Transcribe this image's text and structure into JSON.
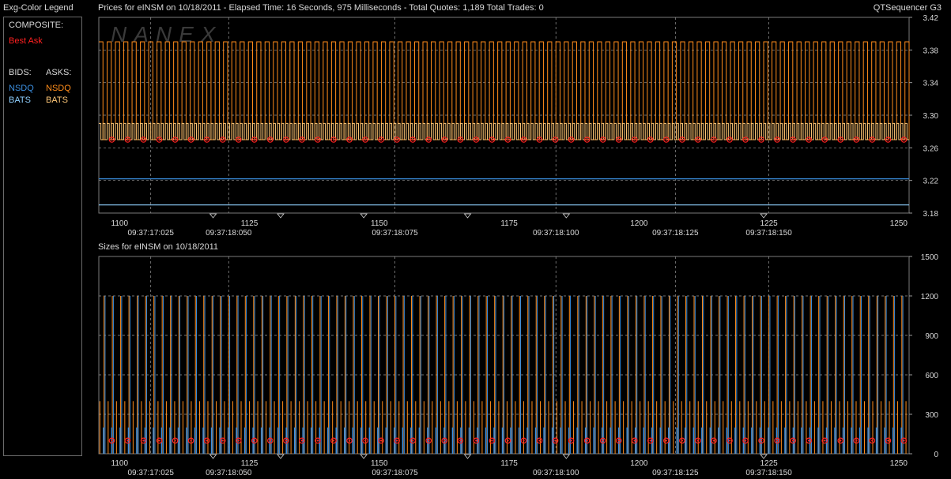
{
  "header": {
    "legend_title": "Exg-Color Legend",
    "title": "Prices for  eINSM  on  10/18/2011  -  Elapsed Time: 16 Seconds, 975 Milliseconds  -  Total Quotes: 1,189  Total Trades: 0",
    "app_name": "QTSequencer G3"
  },
  "legend": {
    "composite_label": "COMPOSITE:",
    "best_ask": "Best Ask",
    "bids_label": "BIDS:",
    "asks_label": "ASKS:",
    "bids": [
      "NSDQ",
      "BATS"
    ],
    "asks": [
      "NSDQ",
      "BATS"
    ]
  },
  "watermark": "NANEX",
  "colors": {
    "best_ask": "#ff2020",
    "nsdq_bid": "#3b8fe0",
    "bats_bid": "#8fd0ff",
    "nsdq_ask": "#ff8c1a",
    "bats_ask": "#ffc878",
    "grid": "#9a9a9a",
    "axis_text": "#d9d9d9"
  },
  "chart_data": [
    {
      "type": "line",
      "title": "Prices for  eINSM  on  10/18/2011  -  Elapsed Time: 16 Seconds, 975 Milliseconds  -  Total Quotes: 1,189  Total Trades: 0",
      "x_range": [
        1096,
        1252
      ],
      "y_range": [
        3.18,
        3.42
      ],
      "ytick_labels": [
        "3.42",
        "3.38",
        "3.34",
        "3.30",
        "3.26",
        "3.22",
        "3.18"
      ],
      "xtick_labels": [
        "1100",
        "1125",
        "1150",
        "1175",
        "1200",
        "1225",
        "1250"
      ],
      "time_labels": [
        "09:37:17:025",
        "09:37:18:050",
        "09:37:18:075",
        "09:37:18:100",
        "09:37:18:125",
        "09:37:18:150"
      ],
      "series": [
        {
          "name": "NSDQ",
          "side": "bid",
          "constant": 3.222
        },
        {
          "name": "BATS",
          "side": "bid",
          "constant": 3.19
        },
        {
          "name": "NSDQ",
          "side": "ask",
          "levels": [
            3.39,
            3.27
          ]
        },
        {
          "name": "BATS",
          "side": "ask",
          "levels": [
            3.29,
            3.27
          ]
        },
        {
          "name": "Best Ask",
          "value": 3.27
        }
      ],
      "grid": true
    },
    {
      "type": "bar",
      "title": "Sizes for  eINSM  on  10/18/2011",
      "x_range": [
        1096,
        1252
      ],
      "y_range": [
        0,
        1500
      ],
      "ytick_labels": [
        "1500",
        "1200",
        "900",
        "600",
        "300",
        "0"
      ],
      "xtick_labels": [
        "1100",
        "1125",
        "1150",
        "1175",
        "1200",
        "1225",
        "1250"
      ],
      "time_labels": [
        "09:37:17:025",
        "09:37:18:050",
        "09:37:18:075",
        "09:37:18:100",
        "09:37:18:125",
        "09:37:18:150"
      ],
      "series": [
        {
          "name": "NSDQ",
          "side": "bid",
          "size": 1200
        },
        {
          "name": "BATS",
          "side": "bid",
          "size": 200
        },
        {
          "name": "NSDQ",
          "side": "ask",
          "size": 1200
        },
        {
          "name": "BATS",
          "side": "ask",
          "size": 400
        },
        {
          "name": "Best Ask",
          "size": 100
        }
      ],
      "grid": true
    }
  ]
}
